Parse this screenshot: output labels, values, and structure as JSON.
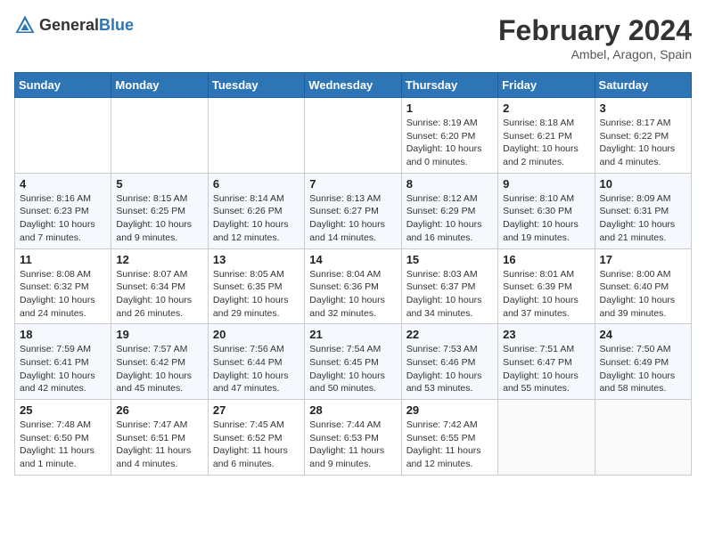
{
  "header": {
    "logo_general": "General",
    "logo_blue": "Blue",
    "month_year": "February 2024",
    "location": "Ambel, Aragon, Spain"
  },
  "weekdays": [
    "Sunday",
    "Monday",
    "Tuesday",
    "Wednesday",
    "Thursday",
    "Friday",
    "Saturday"
  ],
  "weeks": [
    [
      {
        "day": "",
        "info": ""
      },
      {
        "day": "",
        "info": ""
      },
      {
        "day": "",
        "info": ""
      },
      {
        "day": "",
        "info": ""
      },
      {
        "day": "1",
        "info": "Sunrise: 8:19 AM\nSunset: 6:20 PM\nDaylight: 10 hours and 0 minutes."
      },
      {
        "day": "2",
        "info": "Sunrise: 8:18 AM\nSunset: 6:21 PM\nDaylight: 10 hours and 2 minutes."
      },
      {
        "day": "3",
        "info": "Sunrise: 8:17 AM\nSunset: 6:22 PM\nDaylight: 10 hours and 4 minutes."
      }
    ],
    [
      {
        "day": "4",
        "info": "Sunrise: 8:16 AM\nSunset: 6:23 PM\nDaylight: 10 hours and 7 minutes."
      },
      {
        "day": "5",
        "info": "Sunrise: 8:15 AM\nSunset: 6:25 PM\nDaylight: 10 hours and 9 minutes."
      },
      {
        "day": "6",
        "info": "Sunrise: 8:14 AM\nSunset: 6:26 PM\nDaylight: 10 hours and 12 minutes."
      },
      {
        "day": "7",
        "info": "Sunrise: 8:13 AM\nSunset: 6:27 PM\nDaylight: 10 hours and 14 minutes."
      },
      {
        "day": "8",
        "info": "Sunrise: 8:12 AM\nSunset: 6:29 PM\nDaylight: 10 hours and 16 minutes."
      },
      {
        "day": "9",
        "info": "Sunrise: 8:10 AM\nSunset: 6:30 PM\nDaylight: 10 hours and 19 minutes."
      },
      {
        "day": "10",
        "info": "Sunrise: 8:09 AM\nSunset: 6:31 PM\nDaylight: 10 hours and 21 minutes."
      }
    ],
    [
      {
        "day": "11",
        "info": "Sunrise: 8:08 AM\nSunset: 6:32 PM\nDaylight: 10 hours and 24 minutes."
      },
      {
        "day": "12",
        "info": "Sunrise: 8:07 AM\nSunset: 6:34 PM\nDaylight: 10 hours and 26 minutes."
      },
      {
        "day": "13",
        "info": "Sunrise: 8:05 AM\nSunset: 6:35 PM\nDaylight: 10 hours and 29 minutes."
      },
      {
        "day": "14",
        "info": "Sunrise: 8:04 AM\nSunset: 6:36 PM\nDaylight: 10 hours and 32 minutes."
      },
      {
        "day": "15",
        "info": "Sunrise: 8:03 AM\nSunset: 6:37 PM\nDaylight: 10 hours and 34 minutes."
      },
      {
        "day": "16",
        "info": "Sunrise: 8:01 AM\nSunset: 6:39 PM\nDaylight: 10 hours and 37 minutes."
      },
      {
        "day": "17",
        "info": "Sunrise: 8:00 AM\nSunset: 6:40 PM\nDaylight: 10 hours and 39 minutes."
      }
    ],
    [
      {
        "day": "18",
        "info": "Sunrise: 7:59 AM\nSunset: 6:41 PM\nDaylight: 10 hours and 42 minutes."
      },
      {
        "day": "19",
        "info": "Sunrise: 7:57 AM\nSunset: 6:42 PM\nDaylight: 10 hours and 45 minutes."
      },
      {
        "day": "20",
        "info": "Sunrise: 7:56 AM\nSunset: 6:44 PM\nDaylight: 10 hours and 47 minutes."
      },
      {
        "day": "21",
        "info": "Sunrise: 7:54 AM\nSunset: 6:45 PM\nDaylight: 10 hours and 50 minutes."
      },
      {
        "day": "22",
        "info": "Sunrise: 7:53 AM\nSunset: 6:46 PM\nDaylight: 10 hours and 53 minutes."
      },
      {
        "day": "23",
        "info": "Sunrise: 7:51 AM\nSunset: 6:47 PM\nDaylight: 10 hours and 55 minutes."
      },
      {
        "day": "24",
        "info": "Sunrise: 7:50 AM\nSunset: 6:49 PM\nDaylight: 10 hours and 58 minutes."
      }
    ],
    [
      {
        "day": "25",
        "info": "Sunrise: 7:48 AM\nSunset: 6:50 PM\nDaylight: 11 hours and 1 minute."
      },
      {
        "day": "26",
        "info": "Sunrise: 7:47 AM\nSunset: 6:51 PM\nDaylight: 11 hours and 4 minutes."
      },
      {
        "day": "27",
        "info": "Sunrise: 7:45 AM\nSunset: 6:52 PM\nDaylight: 11 hours and 6 minutes."
      },
      {
        "day": "28",
        "info": "Sunrise: 7:44 AM\nSunset: 6:53 PM\nDaylight: 11 hours and 9 minutes."
      },
      {
        "day": "29",
        "info": "Sunrise: 7:42 AM\nSunset: 6:55 PM\nDaylight: 11 hours and 12 minutes."
      },
      {
        "day": "",
        "info": ""
      },
      {
        "day": "",
        "info": ""
      }
    ]
  ]
}
